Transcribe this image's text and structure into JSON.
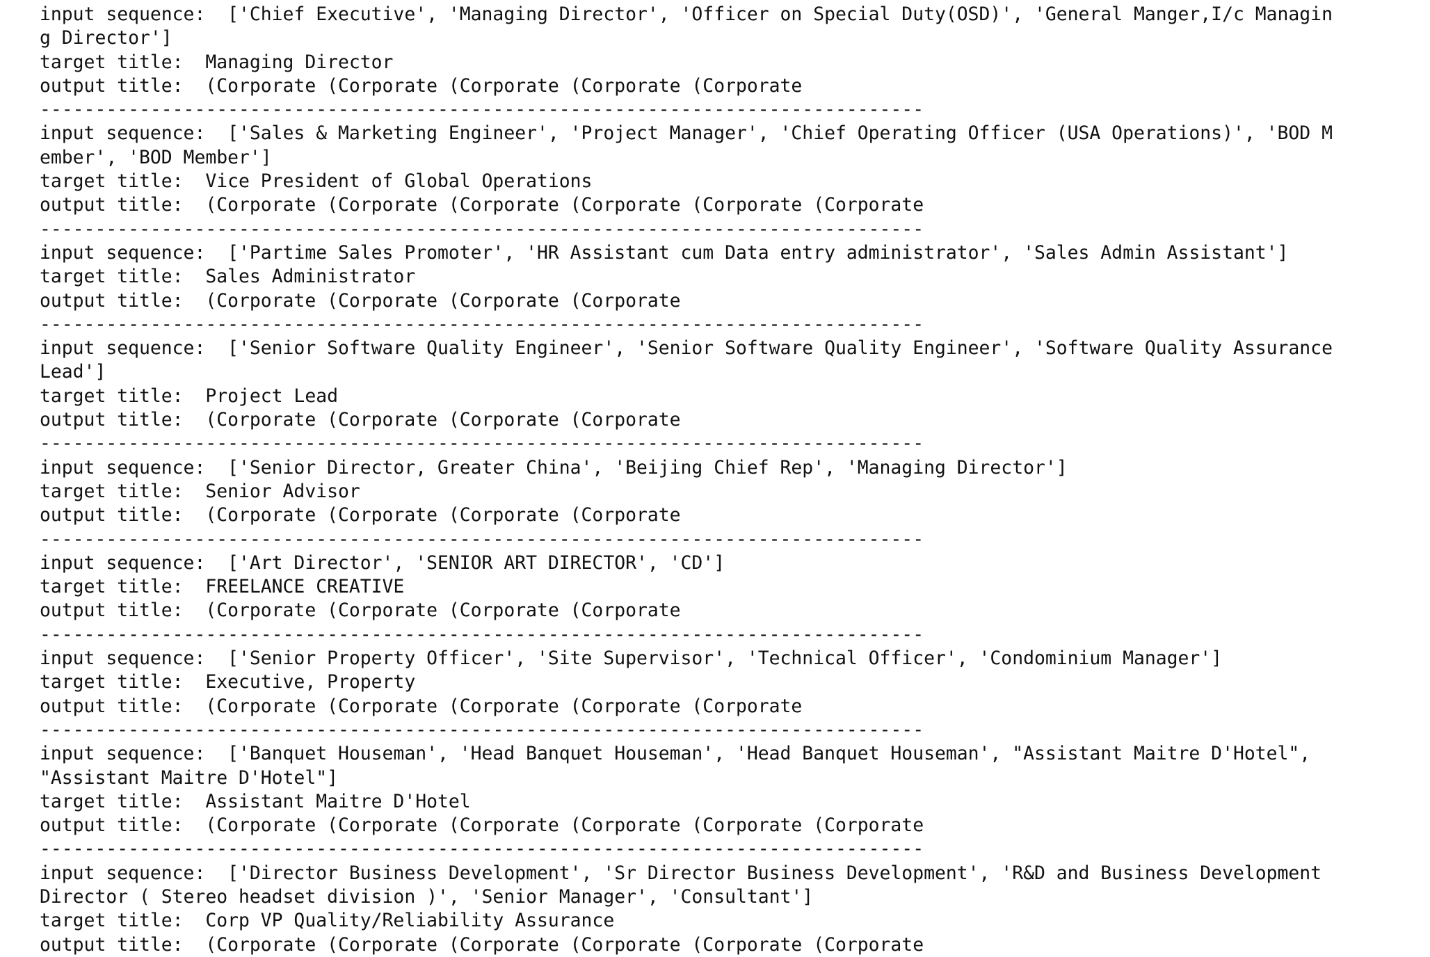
{
  "labels": {
    "input": "input sequence:  ",
    "target": "target title:  ",
    "output": "output title:  "
  },
  "separator": "--------------------------------------------------------------------------------",
  "records": [
    {
      "input_lines": [
        "['Chief Executive', 'Managing Director', 'Officer on Special Duty(OSD)', 'General Manger,I/c Managin",
        "g Director']"
      ],
      "target": "Managing Director",
      "output": "(Corporate (Corporate (Corporate (Corporate (Corporate"
    },
    {
      "input_lines": [
        "['Sales & Marketing Engineer', 'Project Manager', 'Chief Operating Officer (USA Operations)', 'BOD M",
        "ember', 'BOD Member']"
      ],
      "target": "Vice President of Global Operations",
      "output": "(Corporate (Corporate (Corporate (Corporate (Corporate (Corporate"
    },
    {
      "input_lines": [
        "['Partime Sales Promoter', 'HR Assistant cum Data entry administrator', 'Sales Admin Assistant']"
      ],
      "target": "Sales Administrator",
      "output": "(Corporate (Corporate (Corporate (Corporate"
    },
    {
      "input_lines": [
        "['Senior Software Quality Engineer', 'Senior Software Quality Engineer', 'Software Quality Assurance",
        "Lead']"
      ],
      "target": "Project Lead",
      "output": "(Corporate (Corporate (Corporate (Corporate"
    },
    {
      "input_lines": [
        "['Senior Director, Greater China', 'Beijing Chief Rep', 'Managing Director']"
      ],
      "target": "Senior Advisor",
      "output": "(Corporate (Corporate (Corporate (Corporate"
    },
    {
      "input_lines": [
        "['Art Director', 'SENIOR ART DIRECTOR', 'CD']"
      ],
      "target": "FREELANCE CREATIVE",
      "output": "(Corporate (Corporate (Corporate (Corporate"
    },
    {
      "input_lines": [
        "['Senior Property Officer', 'Site Supervisor', 'Technical Officer', 'Condominium Manager']"
      ],
      "target": "Executive, Property",
      "output": "(Corporate (Corporate (Corporate (Corporate (Corporate"
    },
    {
      "input_lines": [
        "['Banquet Houseman', 'Head Banquet Houseman', 'Head Banquet Houseman', \"Assistant Maitre D'Hotel\",",
        "\"Assistant Maitre D'Hotel\"]"
      ],
      "target": "Assistant Maitre D'Hotel",
      "output": "(Corporate (Corporate (Corporate (Corporate (Corporate (Corporate"
    },
    {
      "input_lines": [
        "['Director Business Development', 'Sr Director Business Development', 'R&D and Business Development",
        "Director ( Stereo headset division )', 'Senior Manager', 'Consultant']"
      ],
      "target": "Corp VP Quality/Reliability Assurance",
      "output": "(Corporate (Corporate (Corporate (Corporate (Corporate (Corporate"
    }
  ]
}
